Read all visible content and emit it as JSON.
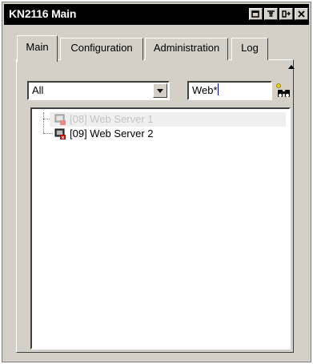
{
  "window": {
    "title": "KN2116 Main"
  },
  "tabs": [
    {
      "label": "Main",
      "active": true
    },
    {
      "label": "Configuration",
      "active": false
    },
    {
      "label": "Administration",
      "active": false
    },
    {
      "label": "Log",
      "active": false
    }
  ],
  "filter": {
    "value": "All"
  },
  "search": {
    "value": "Web*"
  },
  "tree": {
    "nodes": [
      {
        "label": "[08] Web Server 1",
        "disabled": true
      },
      {
        "label": "[09] Web Server 2",
        "disabled": false
      }
    ]
  },
  "icons": {
    "titlebar": [
      "restore-icon",
      "filter-icon",
      "export-icon",
      "close-icon"
    ],
    "find": "binoculars-icon",
    "node": "server-port-icon"
  },
  "colors": {
    "titlebar": "#000000",
    "window": "#d4d0c8",
    "caret": "#0000c8",
    "disabled_text": "#c4c4c4"
  }
}
